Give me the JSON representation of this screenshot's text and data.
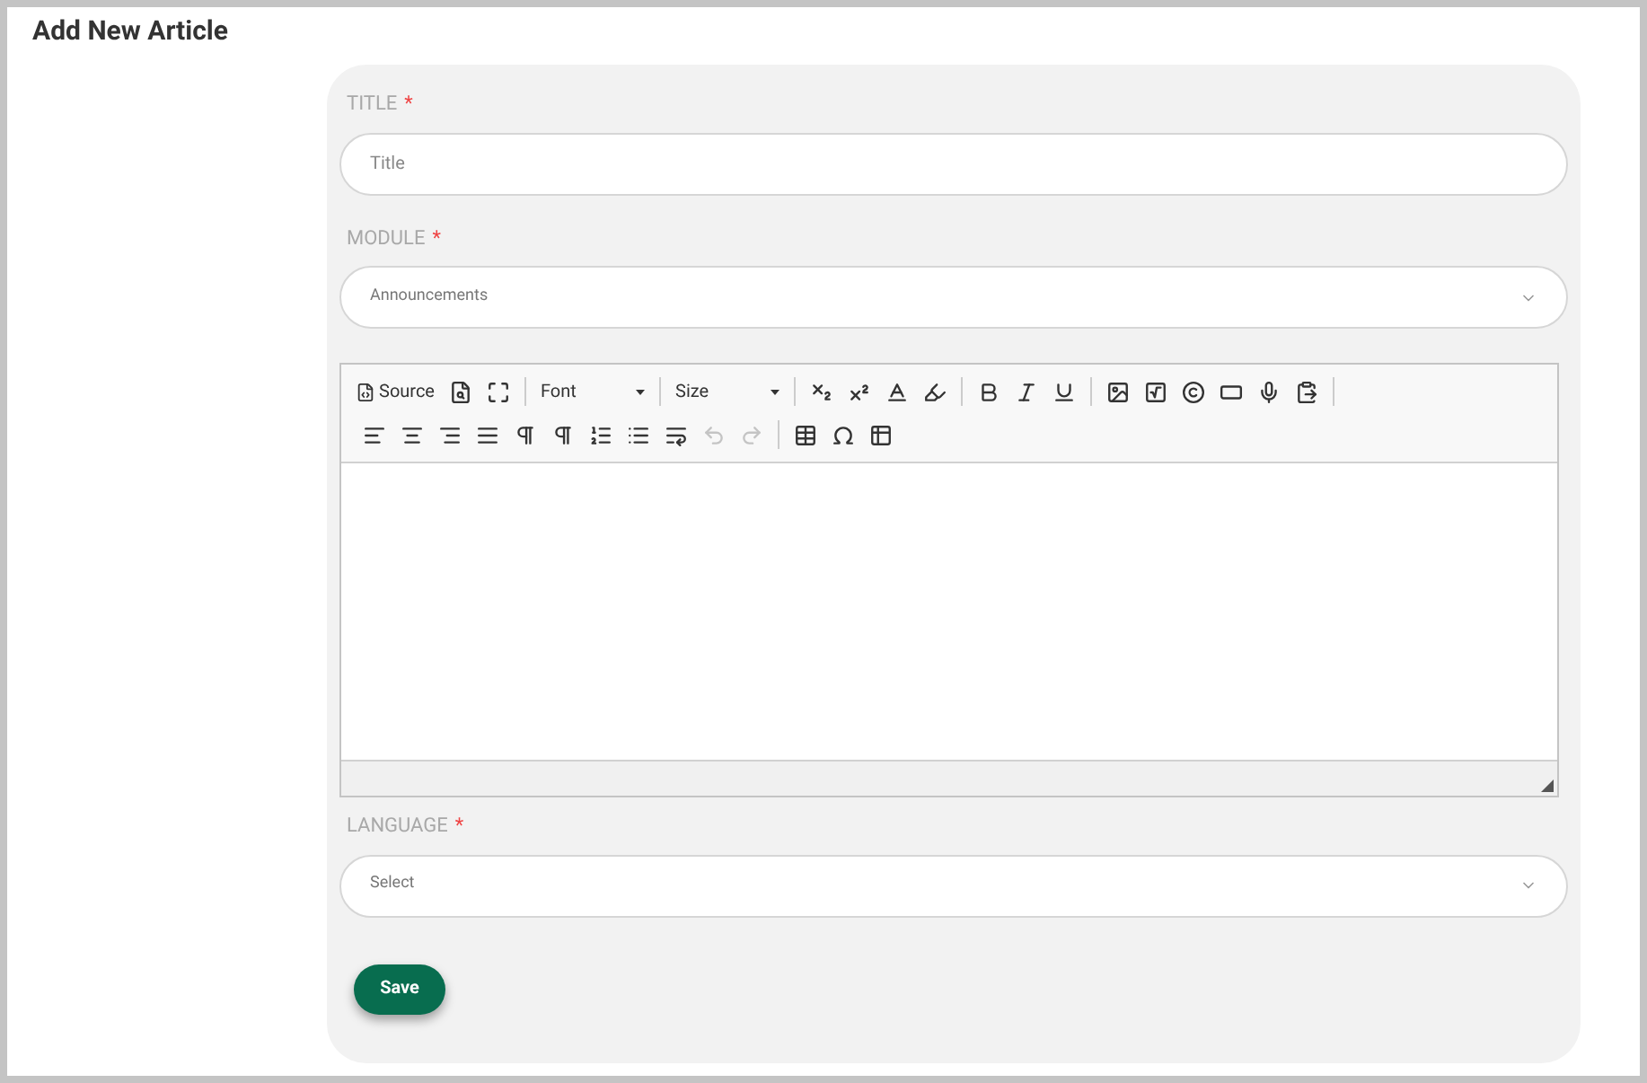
{
  "page_title": "Add New Article",
  "fields": [
    {
      "kind": "text",
      "label": "TITLE",
      "required_mark": "*",
      "placeholder": "Title"
    },
    {
      "kind": "select",
      "label": "MODULE",
      "required_mark": "*",
      "value": "Announcements"
    },
    {
      "kind": "editor",
      "toolbar": {
        "source": "Source",
        "font": "Font",
        "size": "Size",
        "undo": {
          "disabled": true
        },
        "redo": {
          "disabled": true
        }
      }
    },
    {
      "kind": "select",
      "label": "LANGUAGE",
      "required_mark": "*",
      "value": "Select"
    }
  ],
  "save_button": "Save"
}
